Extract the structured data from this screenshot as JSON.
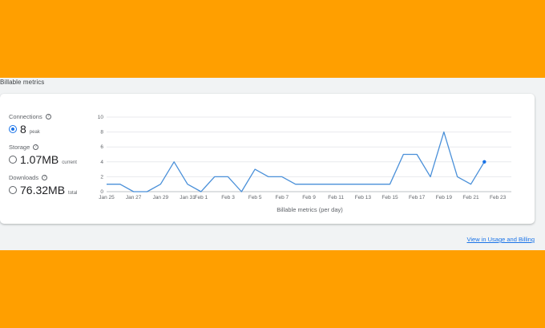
{
  "section": {
    "title": "Billable metrics"
  },
  "metrics": [
    {
      "label": "Connections",
      "value": "8",
      "unit": "peak",
      "selected": true
    },
    {
      "label": "Storage",
      "value": "1.07MB",
      "unit": "current",
      "selected": false
    },
    {
      "label": "Downloads",
      "value": "76.32MB",
      "unit": "total",
      "selected": false
    }
  ],
  "chart_data": {
    "type": "line",
    "xlabel": "Billable metrics (per day)",
    "ylabel": "",
    "ylim": [
      0,
      10
    ],
    "yticks": [
      0,
      2,
      4,
      6,
      8,
      10
    ],
    "xtick_labels": [
      "Jan 25",
      "Jan 27",
      "Jan 29",
      "Jan 31",
      "Feb 1",
      "Feb 3",
      "Feb 5",
      "Feb 7",
      "Feb 9",
      "Feb 11",
      "Feb 13",
      "Feb 15",
      "Feb 17",
      "Feb 19",
      "Feb 21",
      "Feb 23"
    ],
    "x": [
      "Jan 25",
      "Jan 26",
      "Jan 27",
      "Jan 28",
      "Jan 29",
      "Jan 30",
      "Jan 31",
      "Feb 1",
      "Feb 2",
      "Feb 3",
      "Feb 4",
      "Feb 5",
      "Feb 6",
      "Feb 7",
      "Feb 8",
      "Feb 9",
      "Feb 10",
      "Feb 11",
      "Feb 12",
      "Feb 13",
      "Feb 14",
      "Feb 15",
      "Feb 16",
      "Feb 17",
      "Feb 18",
      "Feb 19",
      "Feb 20",
      "Feb 21",
      "Feb 22"
    ],
    "series": [
      {
        "values": [
          1,
          1,
          0,
          0,
          1,
          4,
          1,
          0,
          2,
          2,
          0,
          3,
          2,
          2,
          1,
          1,
          1,
          1,
          1,
          1,
          1,
          1,
          5,
          5,
          2,
          8,
          2,
          1,
          4
        ],
        "color": "#4a90d9"
      }
    ],
    "grid": true
  },
  "footer": {
    "link_label": "View in Usage and Billing"
  }
}
